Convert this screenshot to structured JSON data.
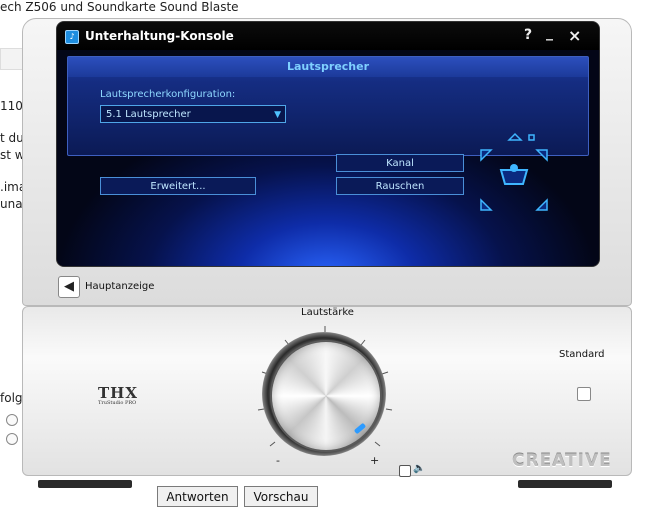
{
  "background": {
    "title": "ech Z506 und Soundkarte Sound Blaste",
    "fragments": [
      "110",
      "t du",
      "st w",
      ".ima",
      "una.",
      "folge"
    ],
    "buttons": {
      "reply": "Antworten",
      "preview": "Vorschau"
    }
  },
  "window": {
    "title": "Unterhaltung-Konsole",
    "help": "?",
    "minimize": "_",
    "close": "×"
  },
  "panel": {
    "header": "Lautsprecher",
    "config_label": "Lautsprecherkonfiguration:",
    "config_value": "5.1 Lautsprecher",
    "advanced_button": "Erweitert...",
    "channel_button": "Kanal",
    "noise_button": "Rauschen"
  },
  "nav": {
    "back_label": "Hauptanzeige"
  },
  "volume": {
    "label": "Lautstärke",
    "min_symbol": "-",
    "max_symbol": "+"
  },
  "standard": {
    "label": "Standard"
  },
  "brand": {
    "thx": "THX",
    "thx_sub": "TruStudio PRO",
    "creative": "CREATIVE"
  },
  "colors": {
    "accent": "#4fc3ff",
    "panel": "#152d82",
    "glow": "#2b67ff"
  },
  "icons": [
    "app-icon",
    "back-arrow-icon",
    "speaker-icon",
    "mute-icon",
    "listener-icon"
  ]
}
